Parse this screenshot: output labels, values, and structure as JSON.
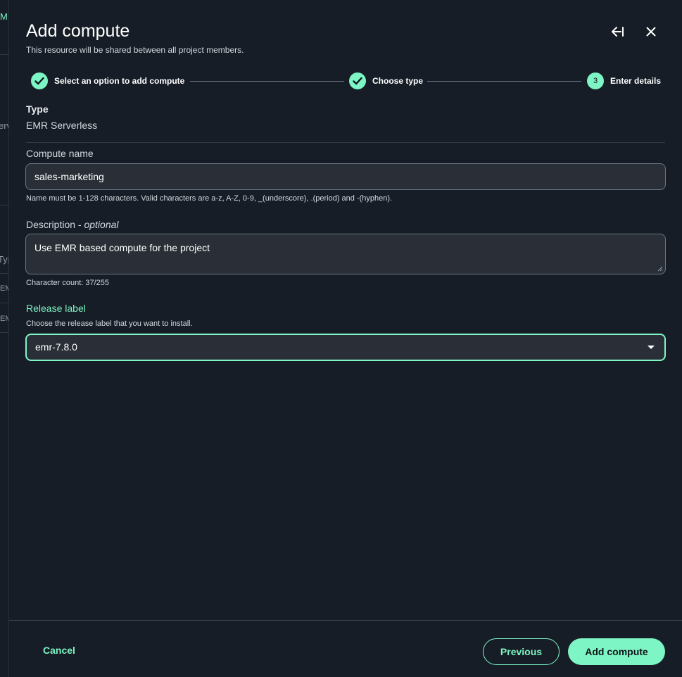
{
  "background": {
    "fragments": [
      "M",
      "erv",
      "Typ",
      "EM",
      "EM"
    ]
  },
  "header": {
    "title": "Add compute",
    "subtitle": "This resource will be shared between all project members."
  },
  "stepper": {
    "steps": [
      {
        "label": "Select an option to add compute",
        "status": "complete"
      },
      {
        "label": "Choose type",
        "status": "complete"
      },
      {
        "label": "Enter details",
        "number": "3",
        "status": "current"
      }
    ]
  },
  "form": {
    "type_label": "Type",
    "type_value": "EMR Serverless",
    "compute_name_label": "Compute name",
    "compute_name_value": "sales-marketing",
    "compute_name_hint": "Name must be 1-128 characters. Valid characters are a-z, A-Z, 0-9, _(underscore), .(period) and -(hyphen).",
    "description_label": "Description - ",
    "description_optional": "optional",
    "description_value": "Use EMR based compute for the project",
    "description_count": "Character count: 37/255",
    "release_label": "Release label",
    "release_hint": "Choose the release label that you want to install.",
    "release_value": "emr-7.8.0"
  },
  "footer": {
    "cancel_label": "Cancel",
    "previous_label": "Previous",
    "submit_label": "Add compute"
  },
  "colors": {
    "accent": "#7ef5c4",
    "background": "#161d26",
    "input_bg": "#2a2f37"
  }
}
